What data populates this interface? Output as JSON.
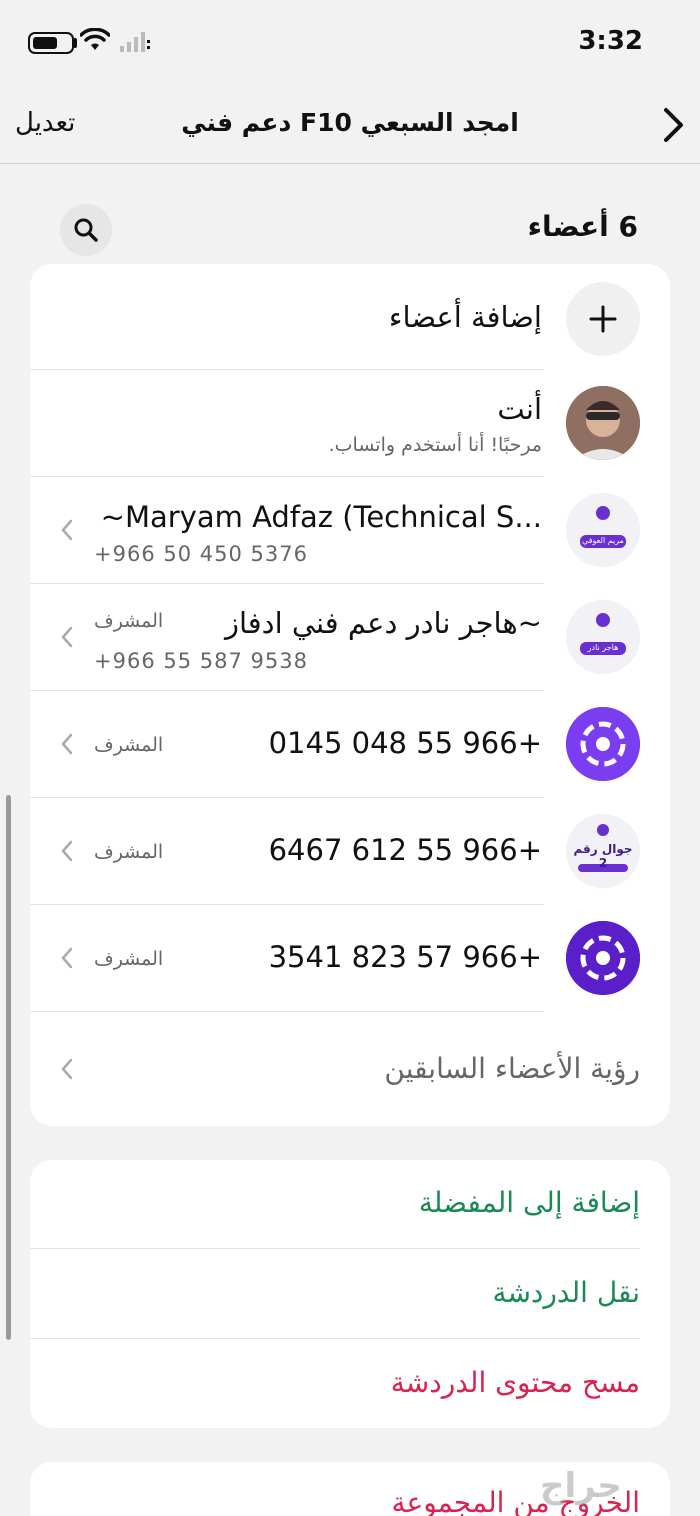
{
  "status_bar": {
    "time": "3:32"
  },
  "nav": {
    "title": "امجد السبعي F10 دعم فني",
    "edit_label": "تعديل"
  },
  "members": {
    "count_label": "6 أعضاء",
    "add_label": "إضافة أعضاء",
    "you": {
      "name": "أنت",
      "status": "مرحبًا! أنا أستخدم واتساب."
    },
    "list": [
      {
        "name": "~Maryam Adfaz (Technical S...",
        "phone": "+966 50 450 5376",
        "role": "",
        "avatar_text": "مريم العوفي"
      },
      {
        "name": "~هاجر نادر دعم فني ادفاز",
        "phone": "+966 55 587 9538",
        "role": "المشرف",
        "avatar_text": "هاجر نادر"
      },
      {
        "name": "+966 55 048 0145",
        "phone": "",
        "role": "المشرف",
        "avatar_text": ""
      },
      {
        "name": "+966 55 612 6467",
        "phone": "",
        "role": "المشرف",
        "avatar_text": "جوال رقم 2"
      },
      {
        "name": "+966 57 823 3541",
        "phone": "",
        "role": "المشرف",
        "avatar_text": ""
      }
    ],
    "past_members_label": "رؤية الأعضاء السابقين"
  },
  "actions": {
    "favorite": "إضافة إلى المفضلة",
    "export": "نقل الدردشة",
    "clear": "مسح محتوى الدردشة",
    "exit": "الخروج من المجموعة"
  },
  "watermark": "حراج",
  "colors": {
    "green": "#1a8a55",
    "red": "#d9224f",
    "purple": "#6a2fd1"
  }
}
